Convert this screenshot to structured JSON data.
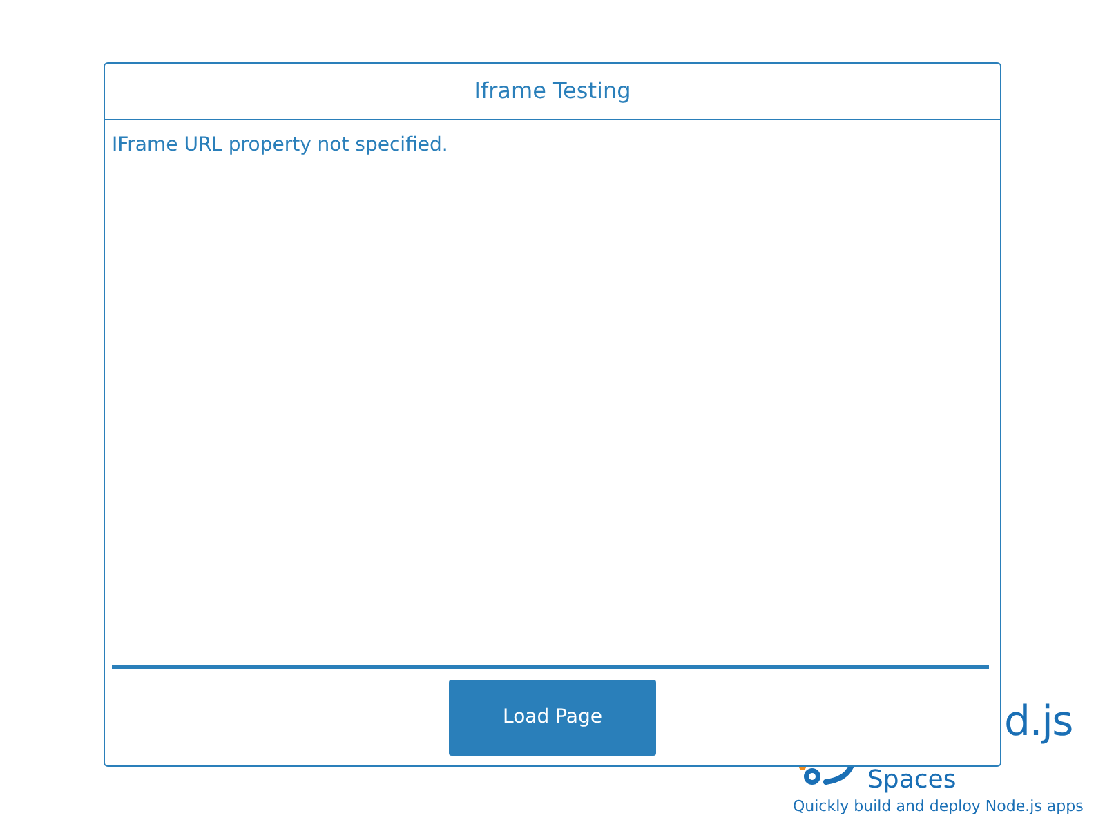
{
  "panel": {
    "title": "Iframe Testing",
    "message": "IFrame URL property not specified.",
    "button": "Load Page"
  },
  "branding": {
    "logo_top": "d.js",
    "logo_bottom": "Spaces",
    "tagline": "Quickly build and deploy Node.js apps"
  }
}
